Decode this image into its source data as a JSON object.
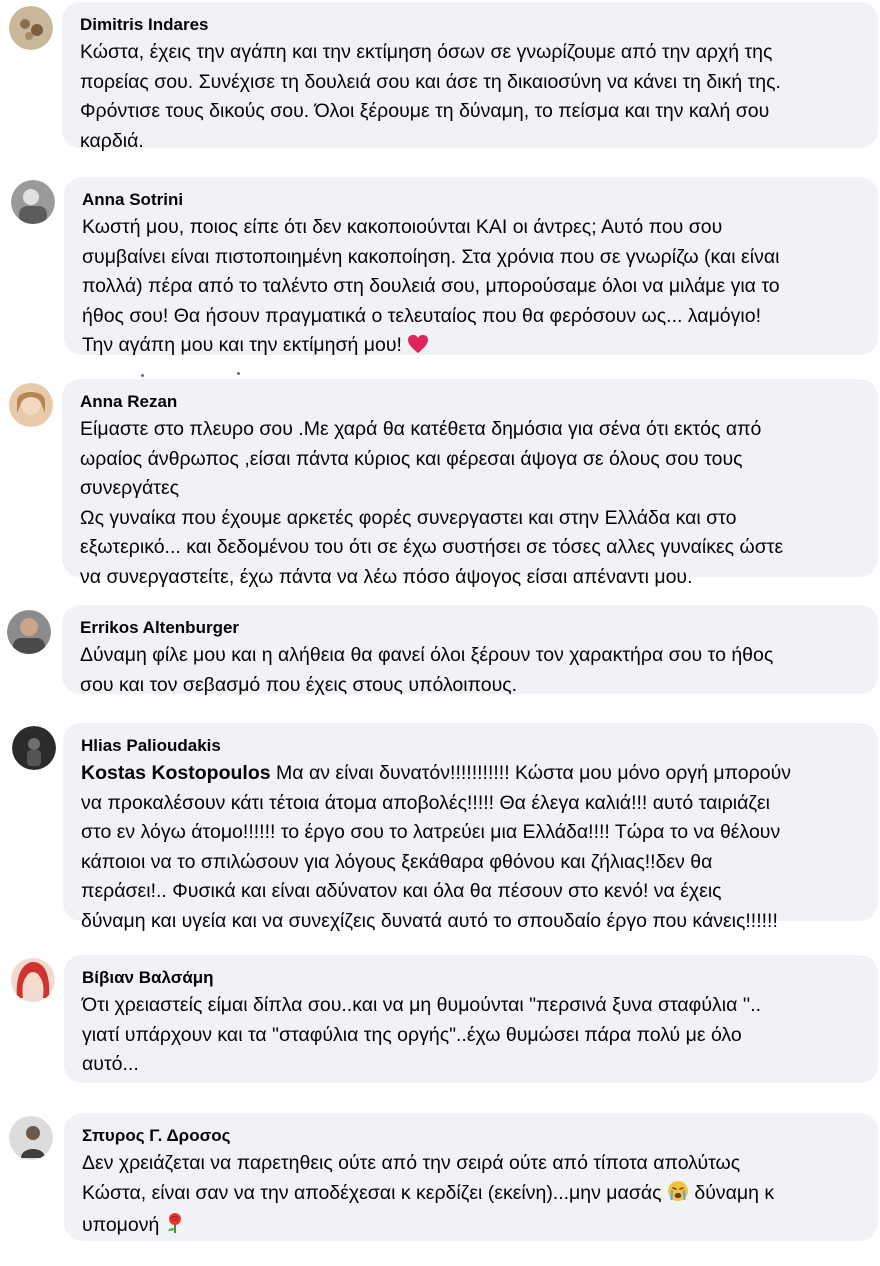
{
  "comments": [
    {
      "author": "Dimitris Indares",
      "text": "Κώστα, έχεις την αγάπη και την εκτίμηση όσων σε γνωρίζουμε από την αρχή της\nπορείας σου. Συνέχισε τη δουλειά σου και άσε τη δικαιοσύνη να κάνει τη δική της.\nΦρόντισε τους δικούς σου. Όλοι ξέρουμε τη δύναμη, το πείσμα και την καλή σου\nκαρδιά."
    },
    {
      "author": "Anna Sotrini",
      "text": "Κωστή μου, ποιος είπε ότι δεν κακοποιούνται ΚΑΙ οι άντρες; Αυτό που σου\nσυμβαίνει είναι πιστοποιημένη κακοποίηση. Στα χρόνια που σε γνωρίζω (και είναι\nπολλά) πέρα από το ταλέντο στη δουλειά σου, μπορούσαμε όλοι να μιλάμε για το\nήθος σου! Θα ήσουν πραγματικά ο τελευταίος που θα φερόσουν ως... λαμόγιο!\nΤην αγάπη μου και την εκτίμησή μου!",
      "emoji": "heart"
    },
    {
      "author": "Anna Rezan",
      "text": "Είμαστε στο πλευρο σου .Με χαρά θα κατέθετα δημόσια για σένα ότι εκτός από\nωραίος άνθρωπος ,είσαι πάντα κύριος και φέρεσαι άψογα σε όλους σου τους\nσυνεργάτες\nΩς γυναίκα που έχουμε αρκετές φορές συνεργαστει και στην Ελλάδα και στο\nεξωτερικό... και δεδομένου του ότι σε έχω συστήσει σε τόσες αλλες γυναίκες ώστε\nνα συνεργαστείτε, έχω πάντα να λέω πόσο άψογος είσαι απέναντι μου."
    },
    {
      "author": "Errikos Altenburger",
      "text": "Δύναμη φίλε μου και η αλήθεια θα φανεί όλοι ξέρουν τον χαρακτήρα σου το ήθος\nσου και τον σεβασμό που έχεις στους υπόλοιπους."
    },
    {
      "author": "Hlias Palioudakis",
      "mention": "Kostas Kostopoulos",
      "text": " Μα αν είναι δυνατόν!!!!!!!!!!! Κώστα μου μόνο οργή μπορούν\nνα προκαλέσουν κάτι τέτοια άτομα αποβολές!!!!! Θα έλεγα καλιά!!! αυτό ταιριάζει\nστο εν λόγω άτομο!!!!!! το έργο σου το λατρεύει μια Ελλάδα!!!! Τώρα το να θέλουν\nκάποιοι να το σπιλώσουν για λόγους ξεκάθαρα φθόνου και ζήλιας!!δεν θα\nπεράσει!.. Φυσικά και είναι αδύνατον και όλα θα πέσουν στο κενό! να έχεις\nδύναμη και υγεία και να συνεχίζεις δυνατά αυτό το σπουδαίο έργο που κάνεις!!!!!!"
    },
    {
      "author": "Βίβιαν Βαλσάμη",
      "text": "Ότι χρειαστείς είμαι δίπλα σου..και να μη θυμούνται \"περσινά ξυνα σταφύλια ''..\nγιατί υπάρχουν και τα \"σταφύλια της οργής\"..έχω θυμώσει πάρα πολύ με όλο\nαυτό..."
    },
    {
      "author": "Σπυρος Γ. Δροσος",
      "text": "Δεν χρειάζεται να παρετηθεις ούτε από την σειρά ούτε από τίποτα απολύτως\nΚώστα, είναι σαν να την αποδέχεσαι κ κερδίζει (εκείνη)...μην μασάς",
      "text_after": " δύναμη κ\nυπομονή ",
      "emoji": "crying-face",
      "emoji_end": "rose"
    }
  ]
}
